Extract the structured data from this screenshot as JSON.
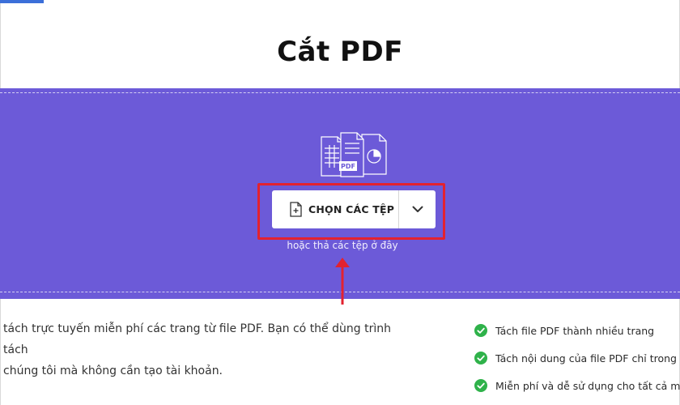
{
  "page": {
    "title": "Cắt PDF"
  },
  "dropzone": {
    "file_illustration_icon": "pdf-files-illustration-icon",
    "choose_files_label": "CHỌN CÁC TỆP",
    "choose_files_icon": "document-add-icon",
    "dropdown_icon": "chevron-down-icon",
    "drop_hint": "hoặc thả các tệp ở đây",
    "annotation_color": "#e3222f",
    "background_color": "#6c5ad8"
  },
  "description": {
    "line1": "tách trực tuyến miễn phí các trang từ file PDF. Bạn có thể dùng trình tách",
    "line2": "chúng tôi mà không cần tạo tài khoản."
  },
  "features": [
    {
      "text": "Tách file PDF thành nhiều trang"
    },
    {
      "text": "Tách nội dung của file PDF chỉ trong vài"
    },
    {
      "text": "Miễn phí và dễ sử dụng cho tất cả mọi n"
    }
  ],
  "colors": {
    "check_green": "#2fb24a",
    "accent_blue": "#3b6fd9"
  }
}
